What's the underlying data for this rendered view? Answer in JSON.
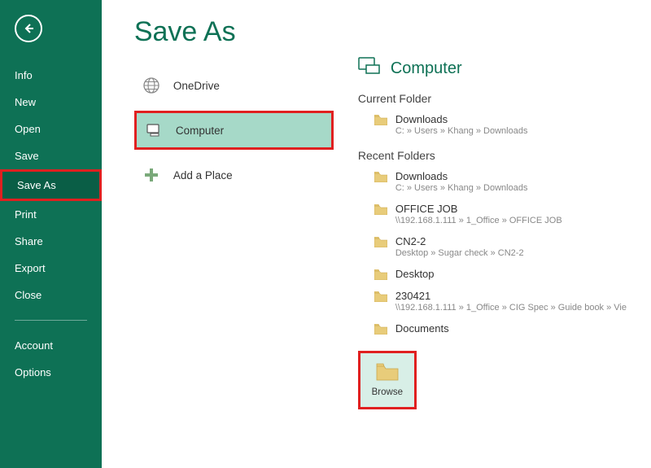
{
  "sidebar": {
    "items": [
      "Info",
      "New",
      "Open",
      "Save",
      "Save As",
      "Print",
      "Share",
      "Export",
      "Close"
    ],
    "bottom": [
      "Account",
      "Options"
    ],
    "selected_index": 4
  },
  "main": {
    "title": "Save As",
    "locations": [
      {
        "label": "OneDrive"
      },
      {
        "label": "Computer"
      },
      {
        "label": "Add a Place"
      }
    ],
    "selected_location_index": 1
  },
  "detail": {
    "header": "Computer",
    "current_folder_label": "Current Folder",
    "recent_folders_label": "Recent Folders",
    "current_folder": {
      "name": "Downloads",
      "path": "C: » Users » Khang » Downloads"
    },
    "recent_folders": [
      {
        "name": "Downloads",
        "path": "C: » Users » Khang » Downloads"
      },
      {
        "name": "OFFICE JOB",
        "path": "\\\\192.168.1.111 » 1_Office » OFFICE JOB"
      },
      {
        "name": "CN2-2",
        "path": "Desktop » Sugar check » CN2-2"
      },
      {
        "name": "Desktop",
        "path": ""
      },
      {
        "name": "230421",
        "path": "\\\\192.168.1.111 » 1_Office » CIG Spec » Guide book » Vie"
      },
      {
        "name": "Documents",
        "path": ""
      }
    ],
    "browse_label": "Browse"
  },
  "colors": {
    "brand": "#0e7155",
    "accent_red": "#e02020"
  }
}
